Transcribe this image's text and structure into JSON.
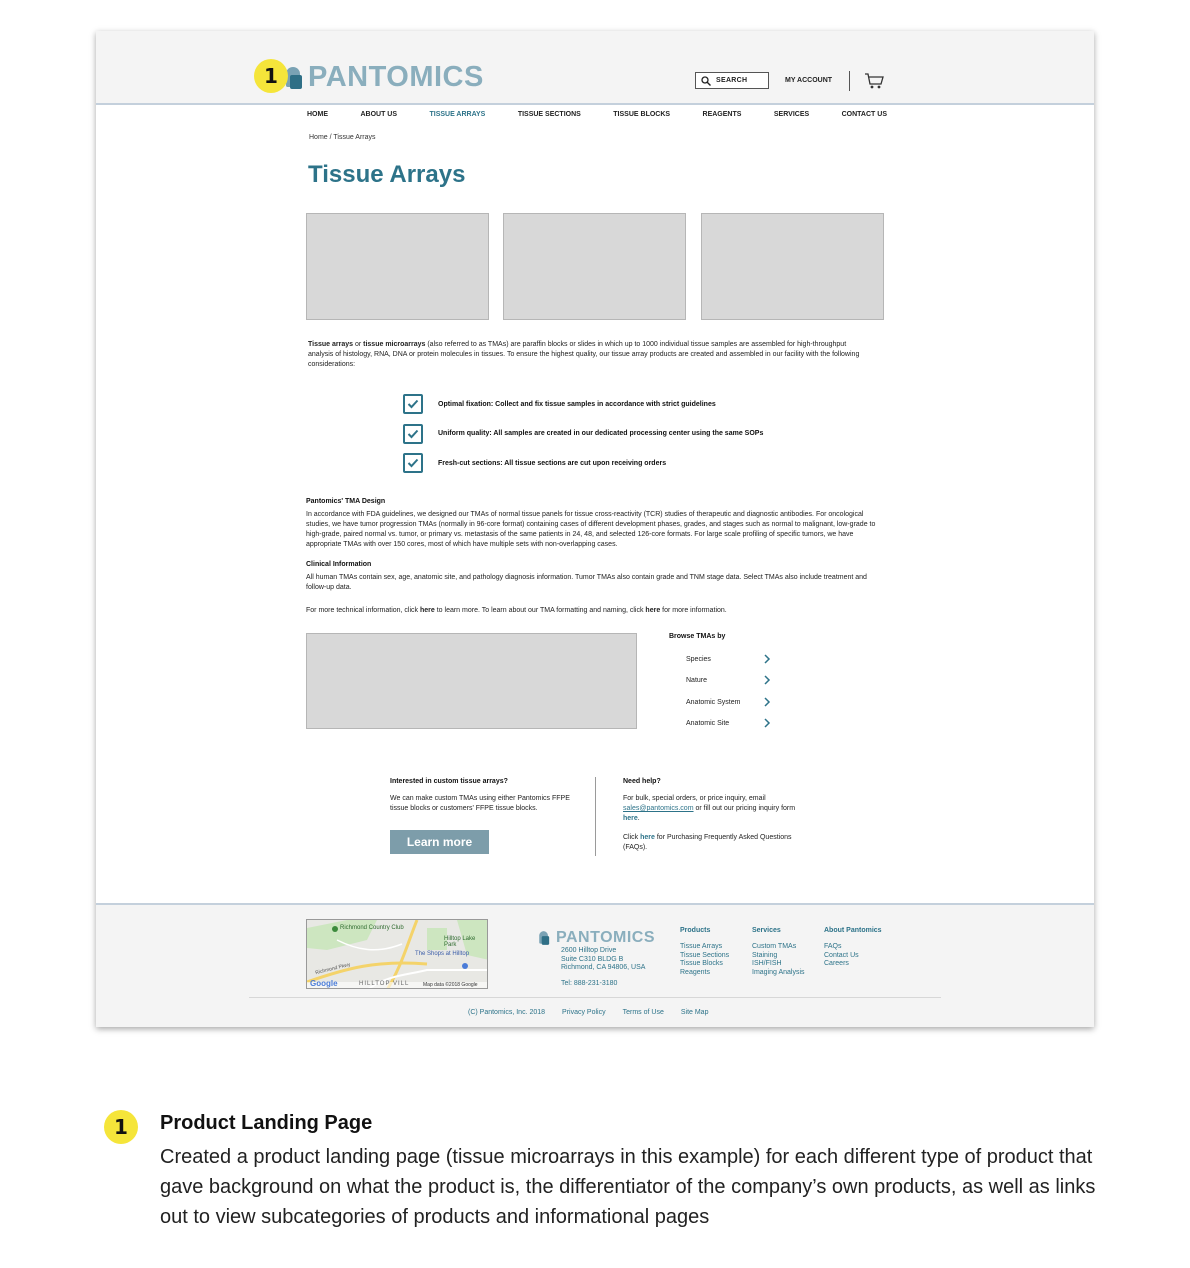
{
  "header": {
    "logo_text": "PANTOMICS",
    "search_label": "SEARCH",
    "account_label": "MY ACCOUNT",
    "marker_number": "1"
  },
  "nav": {
    "items": [
      {
        "label": "HOME"
      },
      {
        "label": "ABOUT US"
      },
      {
        "label": "TISSUE ARRAYS"
      },
      {
        "label": "TISSUE SECTIONS"
      },
      {
        "label": "TISSUE BLOCKS"
      },
      {
        "label": "REAGENTS"
      },
      {
        "label": "SERVICES"
      },
      {
        "label": "CONTACT US"
      }
    ],
    "active_index": 2
  },
  "breadcrumb": "Home / Tissue Arrays",
  "page_title": "Tissue Arrays",
  "intro": {
    "term1": "Tissue arrays",
    "or": " or ",
    "term2": "tissue microarrays",
    "rest": " (also referred to as TMAs) are paraffin blocks or slides in which up to 1000 individual tissue samples are assembled for high-throughput analysis of histology, RNA, DNA or protein molecules in tissues. To ensure the highest quality, our tissue array products are created and assembled in our facility with the following considerations:"
  },
  "checks": [
    {
      "label": "Optimal fixation: Collect and fix tissue samples in accordance with strict guidelines"
    },
    {
      "label": "Uniform quality: All samples are created in our dedicated processing center using the same SOPs"
    },
    {
      "label": "Fresh-cut sections: All tissue sections are cut upon receiving orders"
    }
  ],
  "tma_design": {
    "heading": "Pantomics' TMA Design",
    "body": "In accordance with FDA guidelines, we designed our TMAs of normal tissue panels for tissue cross-reactivity (TCR) studies of therapeutic and diagnostic antibodies. For oncological studies, we have tumor progression TMAs (normally in 96-core format) containing cases of different development phases, grades, and stages such as normal to malignant, low-grade to high-grade, paired normal vs. tumor, or primary vs. metastasis of the same patients in 24, 48, and selected 126-core formats. For large scale profiling of specific tumors, we have appropriate TMAs with over 150 cores, most of which have multiple sets with non-overlapping cases."
  },
  "clinical": {
    "heading": "Clinical Information",
    "body": "All human TMAs contain sex, age, anatomic site, and pathology diagnosis information. Tumor TMAs also contain grade and TNM stage data. Select TMAs also include treatment and follow-up data."
  },
  "more_info": {
    "part1": "For more technical information, click ",
    "here1": "here",
    "part2": " to learn more. To learn about our TMA formatting and naming, click ",
    "here2": "here",
    "part3": " for more information."
  },
  "browse": {
    "heading": "Browse TMAs by",
    "items": [
      {
        "label": "Species"
      },
      {
        "label": "Nature"
      },
      {
        "label": "Anatomic System"
      },
      {
        "label": "Anatomic Site"
      }
    ]
  },
  "custom": {
    "heading": "Interested in custom tissue arrays?",
    "body": "We can make custom TMAs using either Pantomics FFPE tissue blocks or customers' FFPE tissue blocks.",
    "button": "Learn more"
  },
  "help": {
    "heading": "Need help?",
    "p1_text": "For bulk, special orders, or price inquiry, email ",
    "email": "sales@pantomics.com",
    "p1_mid": " or fill out our pricing inquiry form ",
    "p1_link": "here",
    "p1_end": ".",
    "p2_start": "Click ",
    "p2_link": "here",
    "p2_end": " for Purchasing Frequently Asked Questions (FAQs)."
  },
  "footer": {
    "map": {
      "label1": "Richmond Country Club",
      "label2": "Hilltop Lake Park",
      "label3": "The Shops at Hilltop",
      "label4": "Richmond Pkwy",
      "label5": "HILLTOP VILL",
      "credit": "Map data ©2018 Google",
      "brand": "Google"
    },
    "logo_text": "PANTOMICS",
    "address": [
      "2600 Hilltop Drive",
      "Suite C310 BLDG B",
      "Richmond, CA 94806, USA"
    ],
    "tel": "Tel: 888-231-3180",
    "columns": [
      {
        "heading": "Products",
        "items": [
          "Tissue Arrays",
          "Tissue Sections",
          "Tissue Blocks",
          "Reagents"
        ]
      },
      {
        "heading": "Services",
        "items": [
          "Custom TMAs",
          "Staining",
          "ISH/FISH",
          "Imaging Analysis"
        ]
      },
      {
        "heading": "About Pantomics",
        "items": [
          "FAQs",
          "Contact Us",
          "Careers"
        ]
      }
    ],
    "bottom_links": [
      "(C) Pantomics, Inc. 2018",
      "Privacy Policy",
      "Terms of Use",
      "Site Map"
    ]
  },
  "caption": {
    "number": "1",
    "title": "Product Landing Page",
    "body": "Created a product landing page (tissue microarrays in this example) for each different type of product that gave background on what the product is, the differentiator of the company’s own products, as well as links out to view subcategories of products and informational pages"
  },
  "colors": {
    "brand_teal": "#2d7389",
    "logo_light": "#8aaebd",
    "button": "#7d9daa",
    "marker_yellow": "#f5e53a",
    "placeholder": "#d8d8d8"
  }
}
